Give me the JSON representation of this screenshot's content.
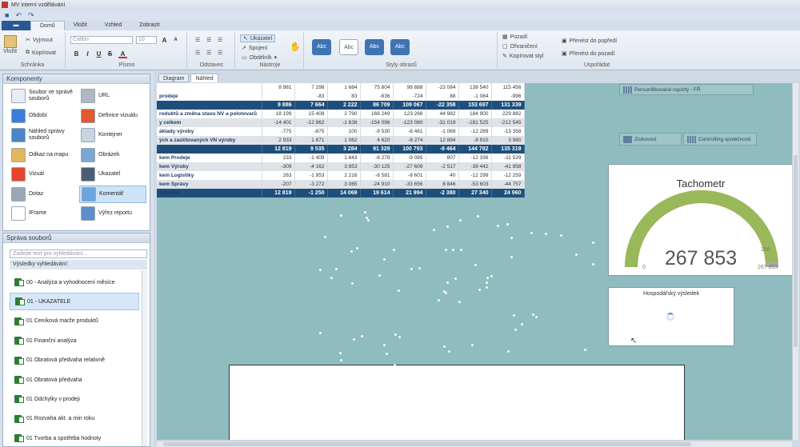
{
  "window": {
    "title": "MV interní vzdělávání"
  },
  "menu": {
    "file": "",
    "tabs": [
      "Domů",
      "Vložit",
      "Vzhled",
      "Zobrazit"
    ]
  },
  "ribbon": {
    "vlozit": "Vložit",
    "vyjmout": "Vyjmout",
    "kopirovat": "Kopírovat",
    "schranka": "Schránka",
    "font_name": "Calibri",
    "font_size": "10",
    "pismo": "Písmo",
    "odstavec": "Odstavec",
    "ukazatel": "Ukazatel",
    "spojeni": "Spojení",
    "obdelnik": "Obdélník",
    "nastroje": "Nástroje",
    "style_labels": [
      "Abc",
      "Abc",
      "Abc",
      "Abc"
    ],
    "styly_obrazu": "Styly obrazů",
    "pozadi": "Pozadí",
    "ohraniceni": "Ohraničení",
    "kopirovat_styl": "Kopírovat styl",
    "prenest_popredi": "Přenést do popředí",
    "prenest_pozadi": "Přenést do pozadí",
    "usporadat": "Uspořádat",
    "bold": "B",
    "italic": "I",
    "underline": "U",
    "strike": "S"
  },
  "components": {
    "title": "Komponenty",
    "items": [
      {
        "label": "Soubor ve správě souborů",
        "color": "#e8eef6"
      },
      {
        "label": "URL",
        "color": "#b0b7c2"
      },
      {
        "label": "Období",
        "color": "#3b7dd8"
      },
      {
        "label": "Definice vizuálu",
        "color": "#e05a2b"
      },
      {
        "label": "Náhled správy souborů",
        "color": "#4c86c9"
      },
      {
        "label": "Kontejner",
        "color": "#c9d4e2"
      },
      {
        "label": "Odkaz na mapu",
        "color": "#e3b65a"
      },
      {
        "label": "Obrázek",
        "color": "#7aa8d6"
      },
      {
        "label": "Vizuál",
        "color": "#e6452e"
      },
      {
        "label": "Ukazatel",
        "color": "#4a5d75"
      },
      {
        "label": "Dotaz",
        "color": "#9aa7b6"
      },
      {
        "label": "Komentář",
        "color": "#6aa5e0"
      },
      {
        "label": "IFrame",
        "color": "#ffffff"
      },
      {
        "label": "Výřez reportu",
        "color": "#5b8fc8"
      }
    ]
  },
  "files": {
    "title": "Správa souborů",
    "search_placeholder": "Zadejte text pro vyhledávání...",
    "results_header": "Výsledky vyhledávání:",
    "items": [
      "00 - Analýza a vyhodnocení měsíce",
      "01 - UKAZATELE",
      "01 Ceníková marže produktů",
      "01 Finanční analýza",
      "01 Obratová předvaha relativně",
      "01 Obratová předvaha",
      "01 Odchylky v prodeji",
      "01 Rozvaha akt. a min roku",
      "01 Tvorba a spotřeba hodnoty"
    ]
  },
  "work": {
    "tabs": [
      "Diagram",
      "Náhled"
    ]
  },
  "table": {
    "rows": [
      {
        "style": "light",
        "label": "",
        "values": [
          "8 981",
          "7 298",
          "1 684",
          "75 804",
          "98 888",
          "-23 084",
          "138 540",
          "115 456"
        ]
      },
      {
        "style": "light",
        "label": "prodeje",
        "values": [
          "",
          "-83",
          "83",
          "-636",
          "-724",
          "88",
          "-1 084",
          "-996"
        ]
      },
      {
        "style": "bold",
        "label": "",
        "values": [
          "9 886",
          "7 664",
          "2 222",
          "86 709",
          "109 067",
          "-22 358",
          "153 697",
          "131 339"
        ]
      },
      {
        "style": "light",
        "label": "roduktů a změna stavu NV a polotovarů",
        "values": [
          "18 199",
          "15 408",
          "2 790",
          "168 249",
          "123 266",
          "44 982",
          "184 900",
          "229 882"
        ]
      },
      {
        "style": "gray",
        "label": "y celkem",
        "values": [
          "-14 401",
          "-12 862",
          "-1 638",
          "-154 096",
          "-123 080",
          "-31 019",
          "-181 525",
          "-212 545"
        ]
      },
      {
        "style": "light",
        "label": "áklady výroby",
        "values": [
          "-775",
          "-875",
          "100",
          "-9 530",
          "-8 461",
          "-1 069",
          "-12 289",
          "-13 358"
        ]
      },
      {
        "style": "gray",
        "label": "ých a zaúčtovaných VN výroby",
        "values": [
          "2 933",
          "1 871",
          "1 062",
          "4 620",
          "-8 274",
          "12 894",
          "-8 915",
          "3 980"
        ]
      },
      {
        "style": "bold",
        "label": "",
        "values": [
          "12 819",
          "9 535",
          "3 284",
          "91 329",
          "100 793",
          "-9 464",
          "144 782",
          "135 319"
        ]
      },
      {
        "style": "light",
        "label": "kem Prodeje",
        "values": [
          "233",
          "-1 409",
          "1 643",
          "-8 278",
          "-9 085",
          "807",
          "-12 336",
          "-11 529"
        ]
      },
      {
        "style": "gray",
        "label": "kem Výroby",
        "values": [
          "-309",
          "-4 162",
          "3 853",
          "-30 125",
          "-27 609",
          "-2 517",
          "-39 442",
          "-41 958"
        ]
      },
      {
        "style": "light",
        "label": "kem Logistiky",
        "values": [
          "263",
          "-1 953",
          "2 216",
          "-8 581",
          "-8 601",
          "40",
          "-12 299",
          "-12 259"
        ]
      },
      {
        "style": "gray",
        "label": "kem Správy",
        "values": [
          "-207",
          "-3 272",
          "3 065",
          "-24 910",
          "-33 656",
          "8 846",
          "-53 603",
          "-44 757"
        ]
      },
      {
        "style": "bold",
        "label": "ýsledek",
        "values": [
          "12 819",
          "-1 250",
          "14 069",
          "19 614",
          "21 994",
          "-2 380",
          "27 340",
          "24 960"
        ]
      }
    ]
  },
  "nav": {
    "personified": "Personifikované reporty - FŘ",
    "ziskovost": "Ziskovost",
    "controlling": "Controlling společnosti"
  },
  "gauge": {
    "title": "Tachometr",
    "value": "267 853",
    "min": "0",
    "max": "256",
    "max_label": "267 853",
    "fill_fraction": 0.98,
    "color_fill": "#99b85a",
    "color_track": "#a8a8a8"
  },
  "hv": {
    "title": "Hospodářský výsledek"
  },
  "colors": {
    "canvas": "#8fbcbe",
    "table_header": "#1e4f7c",
    "accent": "#2b5797"
  }
}
